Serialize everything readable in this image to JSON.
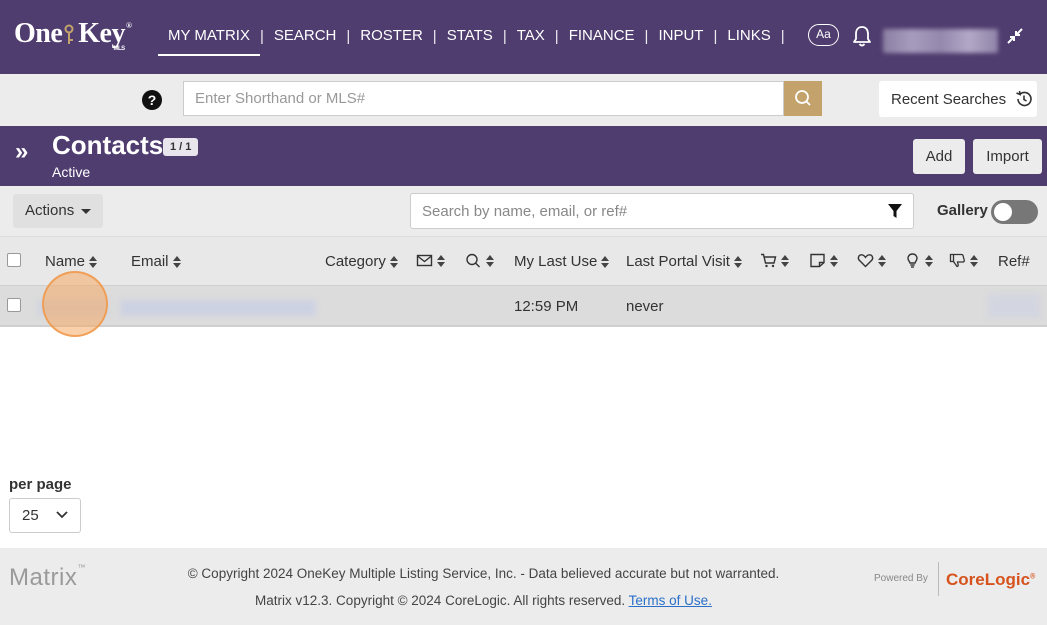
{
  "nav": {
    "logo": {
      "brand_one": "One",
      "brand_key": "Key",
      "brand_mls": "MLS",
      "reg": "®"
    },
    "items": [
      {
        "label": "MY MATRIX",
        "active": true
      },
      {
        "label": "SEARCH"
      },
      {
        "label": "ROSTER"
      },
      {
        "label": "STATS"
      },
      {
        "label": "TAX"
      },
      {
        "label": "FINANCE"
      },
      {
        "label": "INPUT"
      },
      {
        "label": "LINKS"
      }
    ],
    "font_size_button": "Aa",
    "icons": {
      "notifications": "bell-icon",
      "collapse": "collapse-arrows-icon"
    }
  },
  "search": {
    "placeholder": "Enter Shorthand or MLS#",
    "value": "",
    "recent_label": "Recent Searches",
    "help_glyph": "?"
  },
  "contacts": {
    "title": "Contacts",
    "count_badge": "1 / 1",
    "subtitle": "Active",
    "add_label": "Add",
    "import_label": "Import"
  },
  "toolbar": {
    "actions_label": "Actions",
    "search_placeholder": "Search by name, email, or ref#",
    "gallery_label": "Gallery",
    "gallery_on": false
  },
  "table": {
    "columns": {
      "name": "Name",
      "email": "Email",
      "category": "Category",
      "my_last_use": "My Last Use",
      "last_portal_visit": "Last Portal Visit",
      "ref": "Ref#"
    },
    "icon_columns": [
      "envelope-icon",
      "search-icon",
      "cart-icon",
      "note-icon",
      "heart-icon",
      "lightbulb-icon",
      "thumbs-down-icon"
    ],
    "rows": [
      {
        "name": "",
        "email": "",
        "category": "",
        "my_last_use": "12:59 PM",
        "last_portal_visit": "never",
        "ref": ""
      }
    ]
  },
  "pagination": {
    "per_page_label": "per page",
    "per_page_value": "25"
  },
  "footer": {
    "matrix": "Matrix",
    "tm": "™",
    "copyright_line1": "© Copyright 2024 OneKey Multiple Listing Service, Inc. - Data believed accurate but not warranted.",
    "copyright_line2": "Matrix v12.3. Copyright © 2024 CoreLogic. All rights reserved.",
    "terms_label": "Terms of Use.",
    "powered_by": "Powered By",
    "corelogic": "CoreLogic",
    "corelogic_reg": "®"
  },
  "colors": {
    "header_purple": "#4f3d6f",
    "search_gold": "#c3a36b",
    "corelogic_orange": "#d6531e",
    "link_blue": "#2a6fc9"
  }
}
